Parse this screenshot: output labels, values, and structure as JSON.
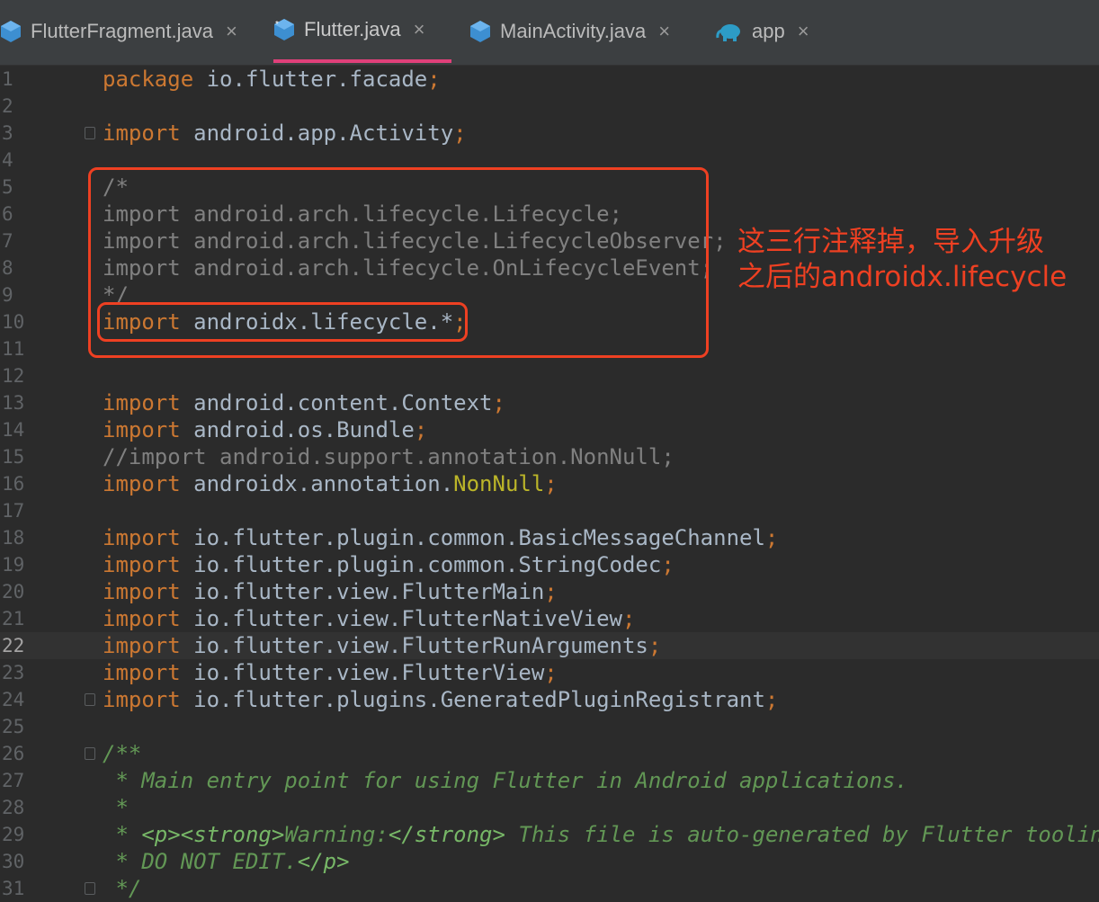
{
  "tabs": [
    {
      "label": "FlutterFragment.java",
      "icon": "java-class-icon",
      "active": false
    },
    {
      "label": "Flutter.java",
      "icon": "java-class-icon",
      "active": true
    },
    {
      "label": "MainActivity.java",
      "icon": "java-class-icon",
      "active": false
    },
    {
      "label": "app",
      "icon": "gradle-elephant-icon",
      "active": false
    }
  ],
  "close_glyph": "×",
  "editor": {
    "line_numbers": [
      "1",
      "2",
      "3",
      "4",
      "5",
      "6",
      "7",
      "8",
      "9",
      "10",
      "11",
      "12",
      "13",
      "14",
      "15",
      "16",
      "17",
      "18",
      "19",
      "20",
      "21",
      "22",
      "23",
      "24",
      "25",
      "26",
      "27",
      "28",
      "29",
      "30",
      "31"
    ],
    "current_line": "22",
    "lines": {
      "l1": {
        "kw": "package",
        "rest": " io.flutter.facade",
        "semi": ";"
      },
      "l3": {
        "kw": "import",
        "rest": " android.app.Activity",
        "semi": ";"
      },
      "l5": "/*",
      "l6": "import android.arch.lifecycle.Lifecycle;",
      "l7": "import android.arch.lifecycle.LifecycleObserver;",
      "l8": "import android.arch.lifecycle.OnLifecycleEvent;",
      "l9": "*/",
      "l10": {
        "kw": "import",
        "rest": " androidx.lifecycle.*",
        "semi": ";"
      },
      "l13": {
        "kw": "import",
        "rest": " android.content.Context",
        "semi": ";"
      },
      "l14": {
        "kw": "import",
        "rest": " android.os.Bundle",
        "semi": ";"
      },
      "l15": "//import android.support.annotation.NonNull;",
      "l16": {
        "kw": "import",
        "rest": " androidx.annotation.",
        "ann": "NonNull",
        "semi": ";"
      },
      "l18": {
        "kw": "import",
        "rest": " io.flutter.plugin.common.BasicMessageChannel",
        "semi": ";"
      },
      "l19": {
        "kw": "import",
        "rest": " io.flutter.plugin.common.StringCodec",
        "semi": ";"
      },
      "l20": {
        "kw": "import",
        "rest": " io.flutter.view.FlutterMain",
        "semi": ";"
      },
      "l21": {
        "kw": "import",
        "rest": " io.flutter.view.FlutterNativeView",
        "semi": ";"
      },
      "l22": {
        "kw": "import",
        "rest": " io.flutter.view.FlutterRunArguments",
        "semi": ";"
      },
      "l23": {
        "kw": "import",
        "rest": " io.flutter.view.FlutterView",
        "semi": ";"
      },
      "l24": {
        "kw": "import",
        "rest": " io.flutter.plugins.GeneratedPluginRegistrant",
        "semi": ";"
      },
      "l26": "/**",
      "l27": " * Main entry point for using Flutter in Android applications.",
      "l28": " *",
      "l29": {
        "prefix": " * ",
        "tag1": "<p><strong>",
        "text1": "Warning:",
        "tag2": "</strong>",
        "text2": " This file is auto-generated by Flutter tooling."
      },
      "l30": {
        "prefix": " * DO NOT EDIT.",
        "tag1": "</p>"
      },
      "l31": " */"
    }
  },
  "annotation": {
    "text_line1": "这三行注释掉，导入升级",
    "text_line2": "之后的androidx.lifecycle",
    "color": "#ee4022"
  }
}
